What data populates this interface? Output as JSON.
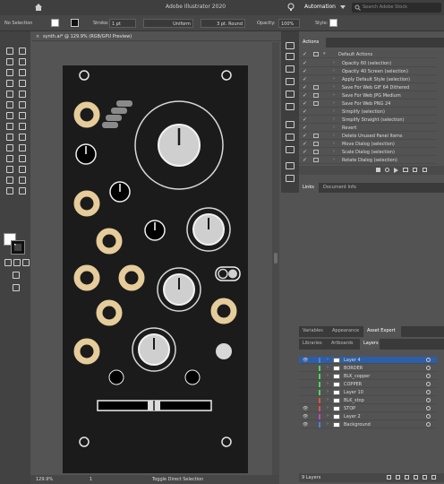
{
  "app": {
    "title": "Adobe Illustrator 2020",
    "workspace": "Automation",
    "search_placeholder": "Search Adobe Stock"
  },
  "control": {
    "selection": "No Selection",
    "stroke_label": "Stroke:",
    "stroke_weight": "1 pt",
    "profile": "Uniform",
    "brush": "3 pt. Round",
    "opacity_label": "Opacity:",
    "opacity": "100%",
    "style_label": "Style:"
  },
  "document": {
    "tab": "synth.ai* @ 129.9% (RGB/GPU Preview)",
    "close": "×"
  },
  "status": {
    "zoom": "129.9%",
    "artboard": "1",
    "tool": "Toggle Direct Selection"
  },
  "actions_panel": {
    "tab": "Actions",
    "set": "Default Actions",
    "items": [
      "Opacity 60 (selection)",
      "Opacity 40 Screen (selection)",
      "Apply Default Style (selection)",
      "Save For Web GIF 64 Dithered",
      "Save For Web JPG Medium",
      "Save For Web PNG 24",
      "Simplify (selection)",
      "Simplify Straight (selection)",
      "Revert",
      "Delete Unused Panel Items",
      "Move Dialog (selection)",
      "Scale Dialog (selection)",
      "Rotate Dialog (selection)"
    ]
  },
  "links_panel": {
    "tabs": [
      "Links",
      "Document Info"
    ]
  },
  "mid_tabs": [
    "Variables",
    "Appearance",
    "Asset Export"
  ],
  "layers_panel": {
    "tabs": [
      "Libraries",
      "Artboards",
      "Layers"
    ],
    "footer": "9 Layers",
    "layers": [
      {
        "name": "Layer 4",
        "color": "#4f7fe0",
        "visible": true
      },
      {
        "name": "BORDER",
        "color": "#4fd85a",
        "visible": false
      },
      {
        "name": "BLK_copper",
        "color": "#4fd85a",
        "visible": false
      },
      {
        "name": "COPPER",
        "color": "#4fd85a",
        "visible": false
      },
      {
        "name": "Layer 10",
        "color": "#4fd85a",
        "visible": false
      },
      {
        "name": "BLK_stop",
        "color": "#e05050",
        "visible": false
      },
      {
        "name": "STOP",
        "color": "#e05050",
        "visible": true
      },
      {
        "name": "Layer 2",
        "color": "#b050c8",
        "visible": true
      },
      {
        "name": "Background",
        "color": "#4f7fe0",
        "visible": true
      }
    ]
  },
  "colors": {
    "panel_bg": "#535353",
    "artboard": "#1b1b1b",
    "jack_gold": "#e5cc9a",
    "highlight": "#2d5ea8"
  }
}
